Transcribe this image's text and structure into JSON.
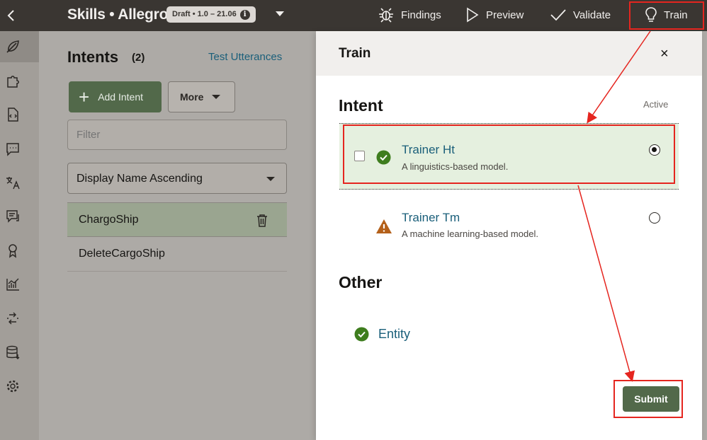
{
  "header": {
    "title": "Skills • Allegro",
    "badge": "Draft • 1.0 – 21.06",
    "badge_info": "i",
    "actions": [
      {
        "label": "Findings",
        "icon": "bug-icon"
      },
      {
        "label": "Preview",
        "icon": "play-icon"
      },
      {
        "label": "Validate",
        "icon": "check-icon"
      },
      {
        "label": "Train",
        "icon": "lightbulb-icon"
      }
    ]
  },
  "rail": {
    "icons": [
      "feather-icon",
      "puzzle-icon",
      "code-file-icon",
      "chat-bubble-icon",
      "translate-icon",
      "conversation-icon",
      "award-icon",
      "analytics-icon",
      "channels-icon",
      "database-icon",
      "settings-icon"
    ]
  },
  "intents": {
    "title": "Intents",
    "count": "(2)",
    "test_link": "Test Utterances",
    "add_label": "Add Intent",
    "more_label": "More",
    "filter_placeholder": "Filter",
    "sort_value": "Display Name Ascending",
    "items": [
      {
        "name": "ChargoShip",
        "selected": true
      },
      {
        "name": "DeleteCargoShip",
        "selected": false
      }
    ]
  },
  "train_dialog": {
    "title": "Train",
    "close": "×",
    "intent_section": "Intent",
    "active_label": "Active",
    "trainers": [
      {
        "name": "Trainer Ht",
        "desc": "A linguistics-based model.",
        "status": "success",
        "selected": true
      },
      {
        "name": "Trainer Tm",
        "desc": "A machine learning-based model.",
        "status": "warning",
        "selected": false
      }
    ],
    "other_section": "Other",
    "other_items": [
      {
        "name": "Entity",
        "status": "success"
      }
    ],
    "submit_label": "Submit"
  },
  "colors": {
    "topbar": "#3a3632",
    "accent_green": "#52694a",
    "link_blue": "#1a5f7a",
    "success": "#3e7d1e",
    "warning": "#b4601a",
    "annotation_red": "#e5251f"
  }
}
